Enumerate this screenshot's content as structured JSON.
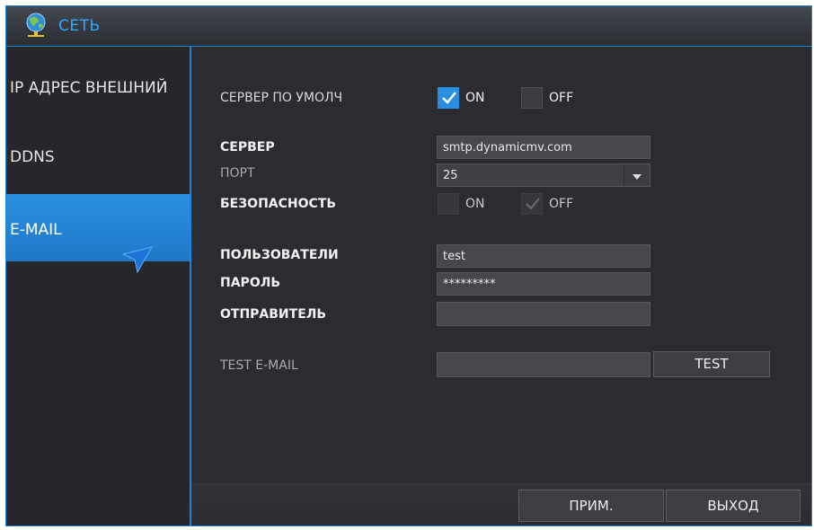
{
  "window": {
    "title": "СЕТЬ",
    "title_icon": "network-globe-icon"
  },
  "sidebar": {
    "items": [
      {
        "label": "IP АДРЕС ВНЕШНИЙ",
        "active": false
      },
      {
        "label": "DDNS",
        "active": false
      },
      {
        "label": "E-MAIL",
        "active": true
      }
    ]
  },
  "email": {
    "default_server": {
      "label": "СЕРВЕР ПО УМОЛЧ",
      "on_label": "ON",
      "off_label": "OFF",
      "on_checked": true,
      "off_checked": false
    },
    "server": {
      "label": "СЕРВЕР",
      "value": "smtp.dynamicmv.com"
    },
    "port": {
      "label": "ПОРТ",
      "value": "25"
    },
    "security": {
      "label": "БЕЗОПАСНОСТЬ",
      "on_label": "ON",
      "off_label": "OFF",
      "on_checked": false,
      "off_checked": true,
      "disabled": true
    },
    "user": {
      "label": "ПОЛЬЗОВАТЕЛИ",
      "value": "test"
    },
    "password": {
      "label": "ПАРОЛЬ",
      "value": "*********"
    },
    "sender": {
      "label": "ОТПРАВИТЕЛЬ",
      "value": ""
    },
    "test_email": {
      "label": "TEST E-MAIL",
      "value": "",
      "button_label": "TEST"
    }
  },
  "footer": {
    "apply_label": "ПРИМ.",
    "exit_label": "ВЫХОД"
  },
  "colors": {
    "accent": "#1d84d8",
    "active_tab": "#2a8ee0",
    "background": "#2a2c31",
    "field": "#45474c"
  }
}
